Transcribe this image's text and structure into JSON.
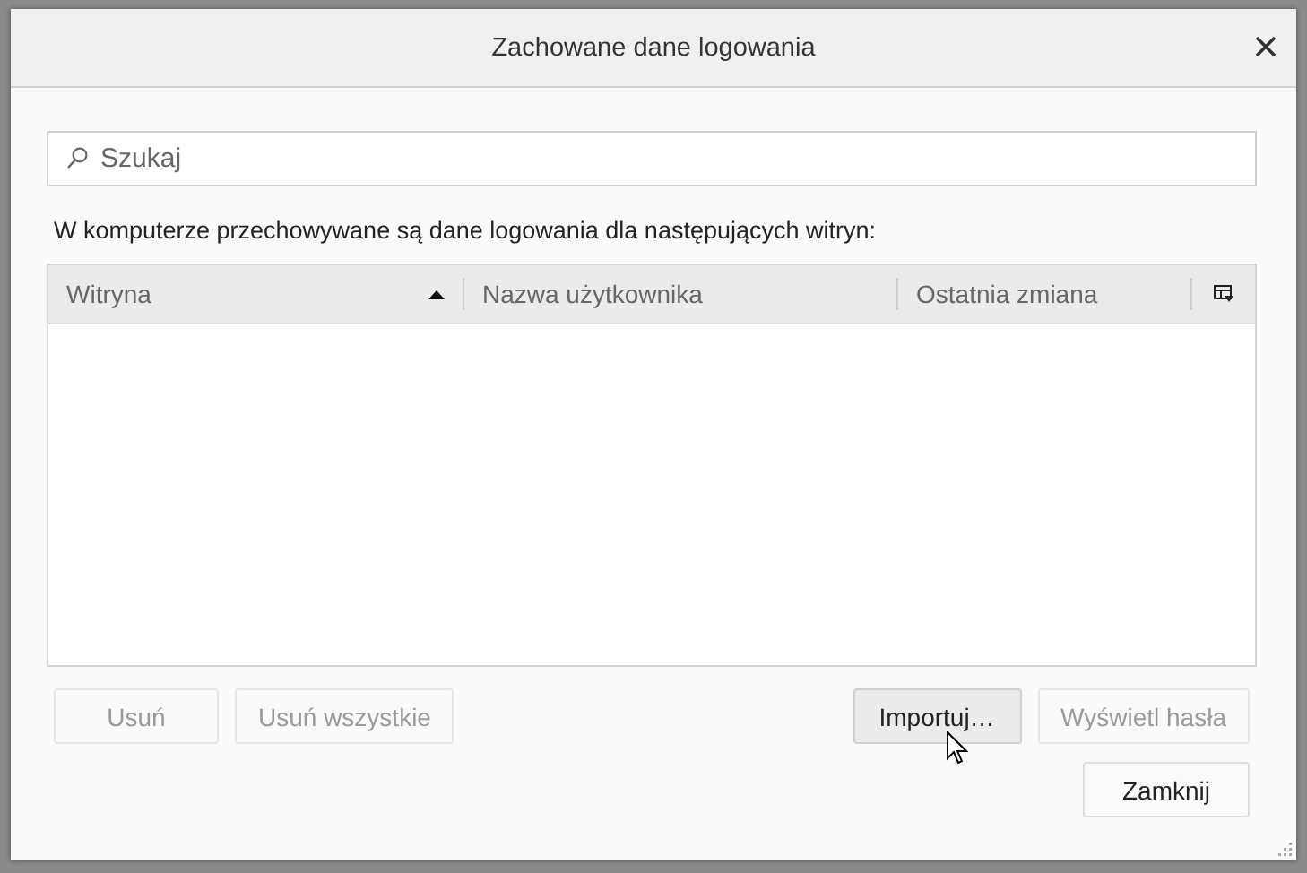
{
  "window": {
    "title": "Zachowane dane logowania"
  },
  "search": {
    "placeholder": "Szukaj"
  },
  "description": "W komputerze przechowywane są dane logowania dla następujących witryn:",
  "table": {
    "columns": [
      {
        "label": "Witryna",
        "sorted": true
      },
      {
        "label": "Nazwa użytkownika",
        "sorted": false
      },
      {
        "label": "Ostatnia zmiana",
        "sorted": false
      }
    ]
  },
  "left_buttons": [
    {
      "label": "Usuń",
      "disabled": true,
      "hovered": false
    },
    {
      "label": "Usuń wszystkie",
      "disabled": true,
      "hovered": false
    }
  ],
  "right_buttons": [
    {
      "label": "Importuj…",
      "disabled": false,
      "hovered": true
    },
    {
      "label": "Wyświetl hasła",
      "disabled": true,
      "hovered": false
    }
  ],
  "footer_button": {
    "label": "Zamknij",
    "disabled": false,
    "hovered": false
  }
}
